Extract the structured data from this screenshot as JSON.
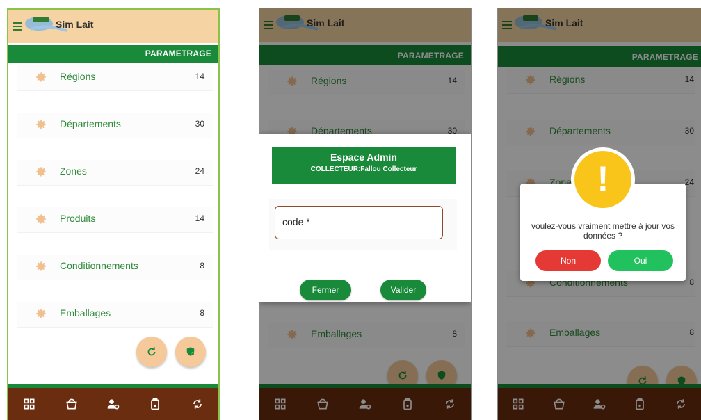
{
  "app": {
    "name": "Sim Lait"
  },
  "section_title": "PARAMETRAGE",
  "items": [
    {
      "label": "Régions",
      "count": "14"
    },
    {
      "label": "Départements",
      "count": "30"
    },
    {
      "label": "Zones",
      "count": "24"
    },
    {
      "label": "Produits",
      "count": "14"
    },
    {
      "label": "Conditionnements",
      "count": "8"
    },
    {
      "label": "Emballages",
      "count": "8"
    }
  ],
  "fabs": [
    {
      "icon": "refresh-icon"
    },
    {
      "icon": "settings-shield-icon"
    }
  ],
  "nav": [
    {
      "icon": "dashboard-grid-icon"
    },
    {
      "icon": "milk-bucket-icon"
    },
    {
      "icon": "user-settings-icon"
    },
    {
      "icon": "milk-jar-icon"
    },
    {
      "icon": "sync-icon"
    }
  ],
  "admin_modal": {
    "title": "Espace Admin",
    "subtitle": "COLLECTEUR:Fallou Collecteur",
    "code_label": "code *",
    "close_label": "Fermer",
    "validate_label": "Valider"
  },
  "confirm_alert": {
    "icon": "!",
    "message": "voulez-vous vraiment mettre à jour vos données ?",
    "no_label": "Non",
    "yes_label": "Oui"
  },
  "colors": {
    "header": "#f5d3a3",
    "primary_green": "#188a3a",
    "nav_brown": "#6b2d0f",
    "gear_orange": "#f0c08e",
    "cancel_red": "#e53935",
    "confirm_green": "#21c25e",
    "warning_yellow": "#f9c51a"
  }
}
